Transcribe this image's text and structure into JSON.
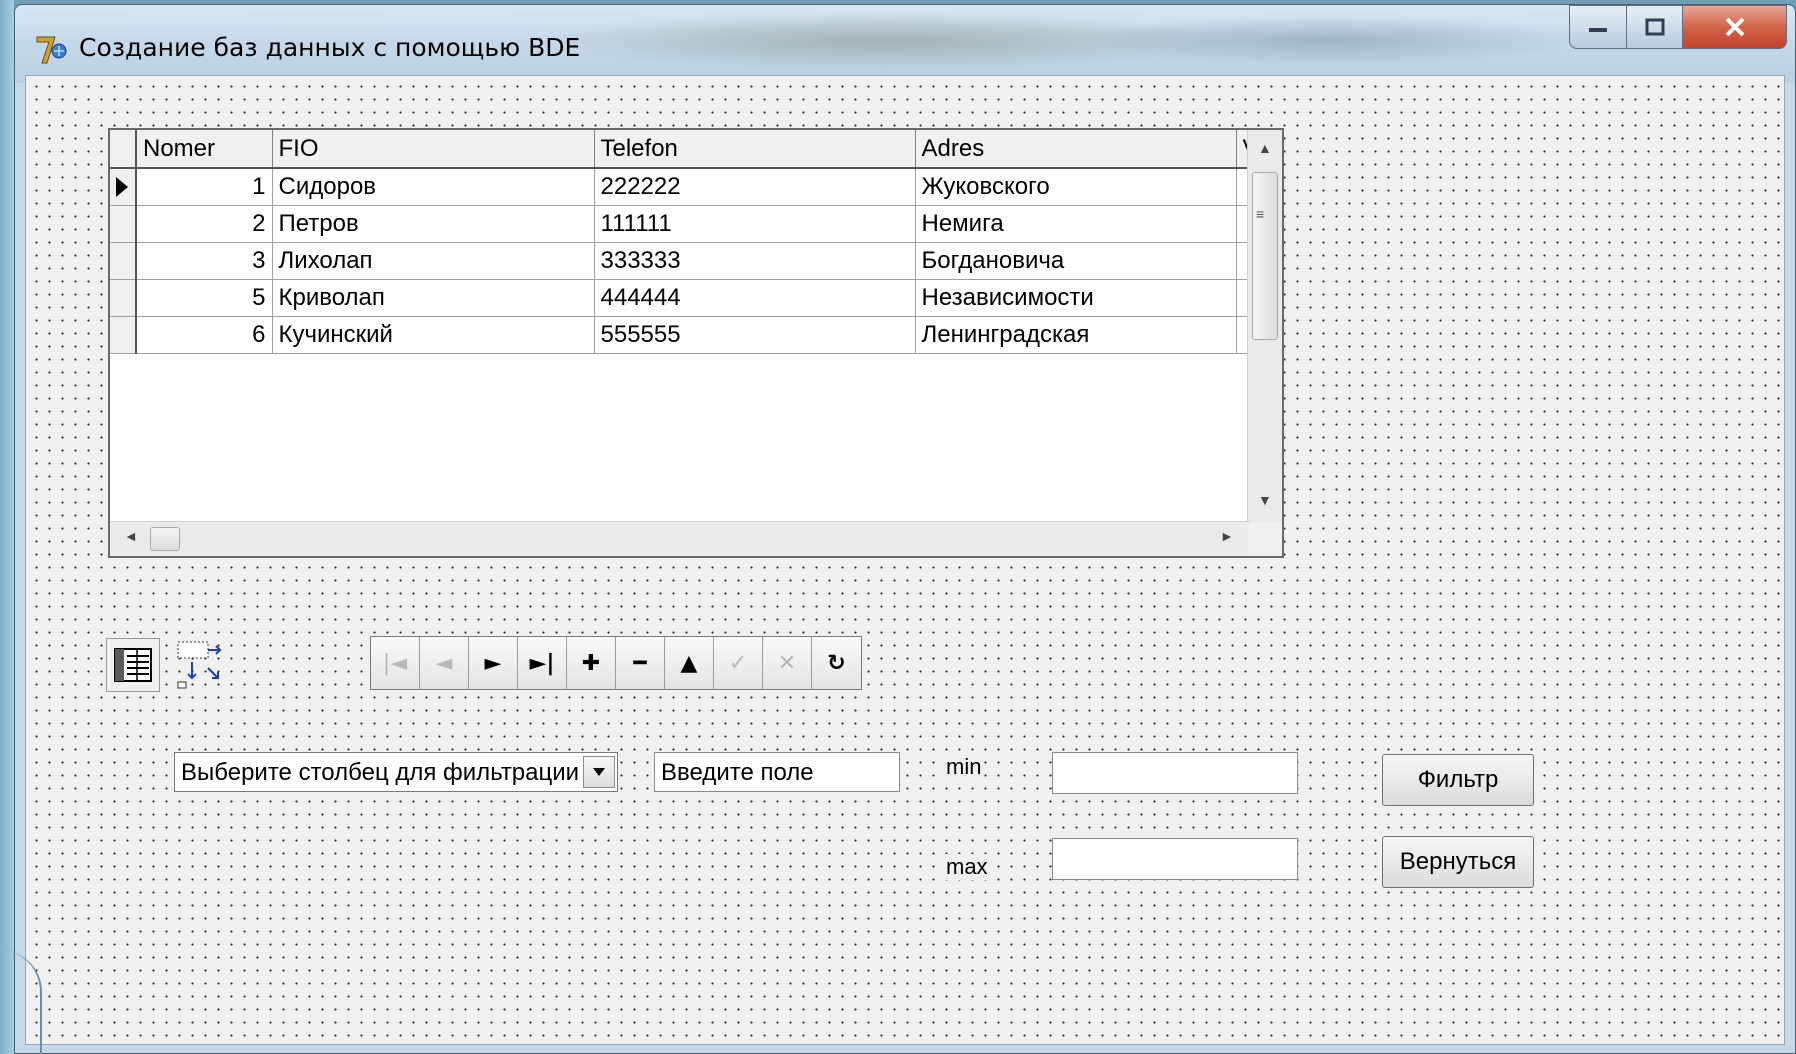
{
  "window": {
    "title": "Создание баз данных с помощью BDE",
    "icon": "delphi-app-icon",
    "controls": {
      "minimize": "minimize-icon",
      "maximize": "maximize-icon",
      "close": "close-icon"
    }
  },
  "grid": {
    "columns": [
      "Nomer",
      "FIO",
      "Telefon",
      "Adres",
      "V"
    ],
    "rows": [
      {
        "nomer": "1",
        "fio": "Сидоров",
        "telefon": "222222",
        "adres": "Жуковского",
        "current": true
      },
      {
        "nomer": "2",
        "fio": "Петров",
        "telefon": "111111",
        "adres": "Немига",
        "current": false
      },
      {
        "nomer": "3",
        "fio": "Лихолап",
        "telefon": "333333",
        "adres": "Богдановича",
        "current": false
      },
      {
        "nomer": "5",
        "fio": "Криволап",
        "telefon": "444444",
        "adres": "Независимости",
        "current": false
      },
      {
        "nomer": "6",
        "fio": "Кучинский",
        "telefon": "555555",
        "adres": "Ленинградская",
        "current": false
      }
    ]
  },
  "components": {
    "datasource": "datasource-component-icon",
    "table": "table-component-icon"
  },
  "navigator": {
    "buttons": [
      {
        "name": "first",
        "glyph": "|◄",
        "enabled": false
      },
      {
        "name": "prior",
        "glyph": "◄",
        "enabled": false
      },
      {
        "name": "next",
        "glyph": "►",
        "enabled": true
      },
      {
        "name": "last",
        "glyph": "►|",
        "enabled": true
      },
      {
        "name": "insert",
        "glyph": "✚",
        "enabled": true
      },
      {
        "name": "delete",
        "glyph": "━",
        "enabled": true
      },
      {
        "name": "edit",
        "glyph": "▲",
        "enabled": true
      },
      {
        "name": "post",
        "glyph": "✓",
        "enabled": false
      },
      {
        "name": "cancel",
        "glyph": "✕",
        "enabled": false
      },
      {
        "name": "refresh",
        "glyph": "↻",
        "enabled": true
      }
    ]
  },
  "filter": {
    "column_select": "Выберите столбец для фильтрации",
    "field_input": "Введите поле",
    "min_label": "min",
    "max_label": "max",
    "min_value": "",
    "max_value": "",
    "filter_button": "Фильтр",
    "back_button": "Вернуться"
  }
}
